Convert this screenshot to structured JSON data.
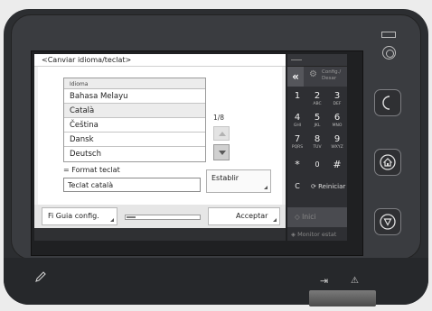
{
  "screen": {
    "title": "<Canviar idioma/teclat>",
    "language_list": {
      "header": "Idioma",
      "items": [
        "Bahasa Melayu",
        "Català",
        "Čeština",
        "Dansk",
        "Deutsch"
      ],
      "selected_index": 1,
      "page_indicator": "1/8"
    },
    "keyboard_format": {
      "label": "= Format teclat",
      "value": "Teclat català",
      "set_button": "Establir"
    },
    "footer": {
      "guide_button": "Fi Guia config.",
      "accept_button": "Acceptar",
      "progress_fraction": 0.12
    }
  },
  "keypad": {
    "config_label_1": "Config./",
    "config_label_2": "Desar",
    "back_label": "«",
    "keys": [
      {
        "digit": "1",
        "letters": ""
      },
      {
        "digit": "2",
        "letters": "ABC"
      },
      {
        "digit": "3",
        "letters": "DEF"
      },
      {
        "digit": "4",
        "letters": "GHI"
      },
      {
        "digit": "5",
        "letters": "JKL"
      },
      {
        "digit": "6",
        "letters": "MNO"
      },
      {
        "digit": "7",
        "letters": "PQRS"
      },
      {
        "digit": "8",
        "letters": "TUV"
      },
      {
        "digit": "9",
        "letters": "WXYZ"
      },
      {
        "digit": "*",
        "letters": ""
      },
      {
        "digit": "0",
        "letters": ""
      },
      {
        "digit": "#",
        "letters": ""
      }
    ],
    "clear_label": "C",
    "reset_label": "Reiniciar",
    "start_label": "Inici",
    "monitor_label": "Monitor estat"
  },
  "icons": {
    "sleep": "moon-icon",
    "home": "home-icon",
    "stop": "stop-icon",
    "pen": "pen-icon",
    "login": "login-icon",
    "warning": "warning-icon"
  }
}
